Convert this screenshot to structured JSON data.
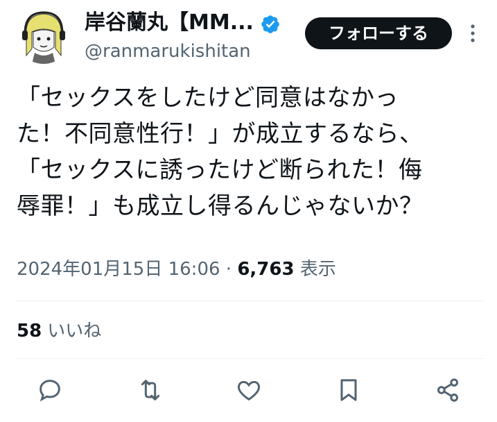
{
  "author": {
    "display_name": "岸谷蘭丸【MM...",
    "handle": "@ranmarukishitan",
    "verified": true,
    "avatar_icon": "avatar-illustration"
  },
  "header": {
    "follow_label": "フォローする",
    "more_icon": "more-vertical-icon"
  },
  "tweet": {
    "text": "「セックスをしたけど同意はなかっ\nた！不同意性行！」が成立するなら、\n「セックスに誘ったけど断られた！侮\n辱罪！」も成立し得るんじゃないか？",
    "timestamp": "2024年01月15日 16:06",
    "separator": "·",
    "views_count": "6,763",
    "views_label": "表示"
  },
  "engagement": {
    "likes_count": "58",
    "likes_label": "いいね"
  },
  "actions": [
    "reply-icon",
    "retweet-icon",
    "like-icon",
    "bookmark-icon",
    "share-icon"
  ],
  "colors": {
    "text_primary": "#0f1419",
    "text_secondary": "#536471",
    "verified_blue": "#1d9bf0",
    "divider": "#eff3f4",
    "follow_bg": "#0f1419"
  }
}
